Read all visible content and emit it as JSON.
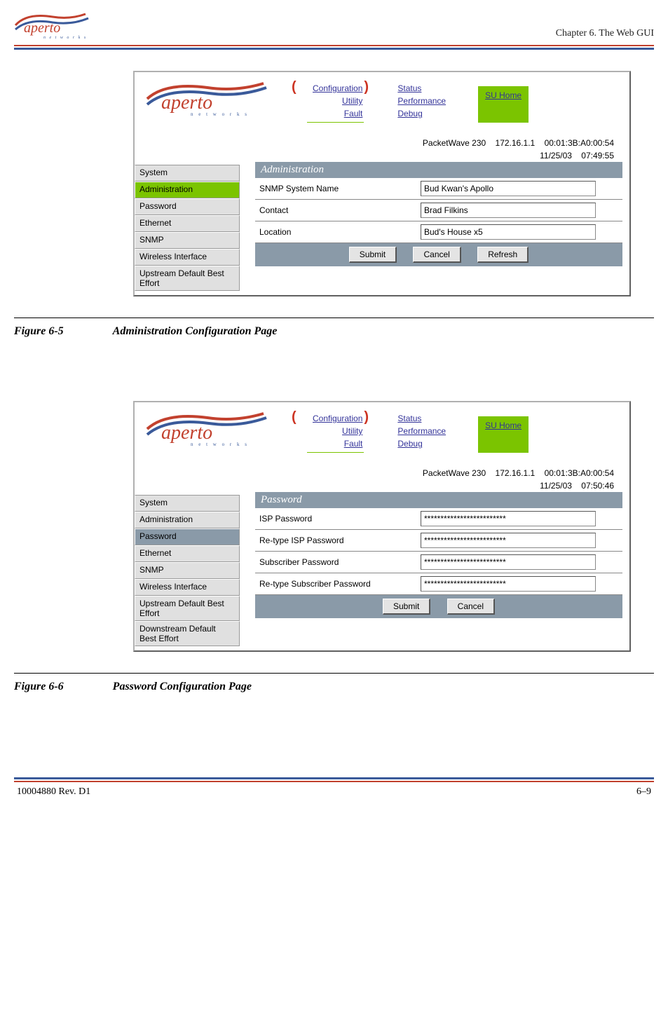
{
  "doc": {
    "brand": "aperto",
    "brand_sub": "networks",
    "chapter": "Chapter 6.  The Web GUI",
    "footer_left": "10004880 Rev. D1",
    "footer_right": "6–9"
  },
  "nav": {
    "group1": [
      "Configuration",
      "Utility",
      "Fault"
    ],
    "group2": [
      "Status",
      "Performance",
      "Debug"
    ],
    "home": "SU Home"
  },
  "device": {
    "model": "PacketWave 230",
    "ip": "172.16.1.1",
    "mac": "00:01:3B:A0:00:54"
  },
  "fig1": {
    "date": "11/25/03",
    "time": "07:49:55",
    "sidebar": [
      "System",
      "Administration",
      "Password",
      "Ethernet",
      "SNMP",
      "Wireless Interface",
      "Upstream Default Best Effort"
    ],
    "panel_title": "Administration",
    "rows": [
      {
        "label": "SNMP System Name",
        "value": "Bud Kwan's Apollo"
      },
      {
        "label": "Contact",
        "value": "Brad Filkins"
      },
      {
        "label": "Location",
        "value": "Bud's House x5"
      }
    ],
    "buttons": [
      "Submit",
      "Cancel",
      "Refresh"
    ],
    "caption_num": "Figure 6-5",
    "caption_text": "Administration Configuration Page"
  },
  "fig2": {
    "date": "11/25/03",
    "time": "07:50:46",
    "sidebar": [
      "System",
      "Administration",
      "Password",
      "Ethernet",
      "SNMP",
      "Wireless Interface",
      "Upstream Default Best Effort",
      "Downstream Default Best Effort"
    ],
    "panel_title": "Password",
    "rows": [
      {
        "label": "ISP Password",
        "value": "*************************"
      },
      {
        "label": "Re-type ISP Password",
        "value": "*************************"
      },
      {
        "label": "Subscriber Password",
        "value": "*************************"
      },
      {
        "label": "Re-type Subscriber Password",
        "value": "*************************"
      }
    ],
    "buttons": [
      "Submit",
      "Cancel"
    ],
    "caption_num": "Figure 6-6",
    "caption_text": "Password Configuration Page"
  }
}
